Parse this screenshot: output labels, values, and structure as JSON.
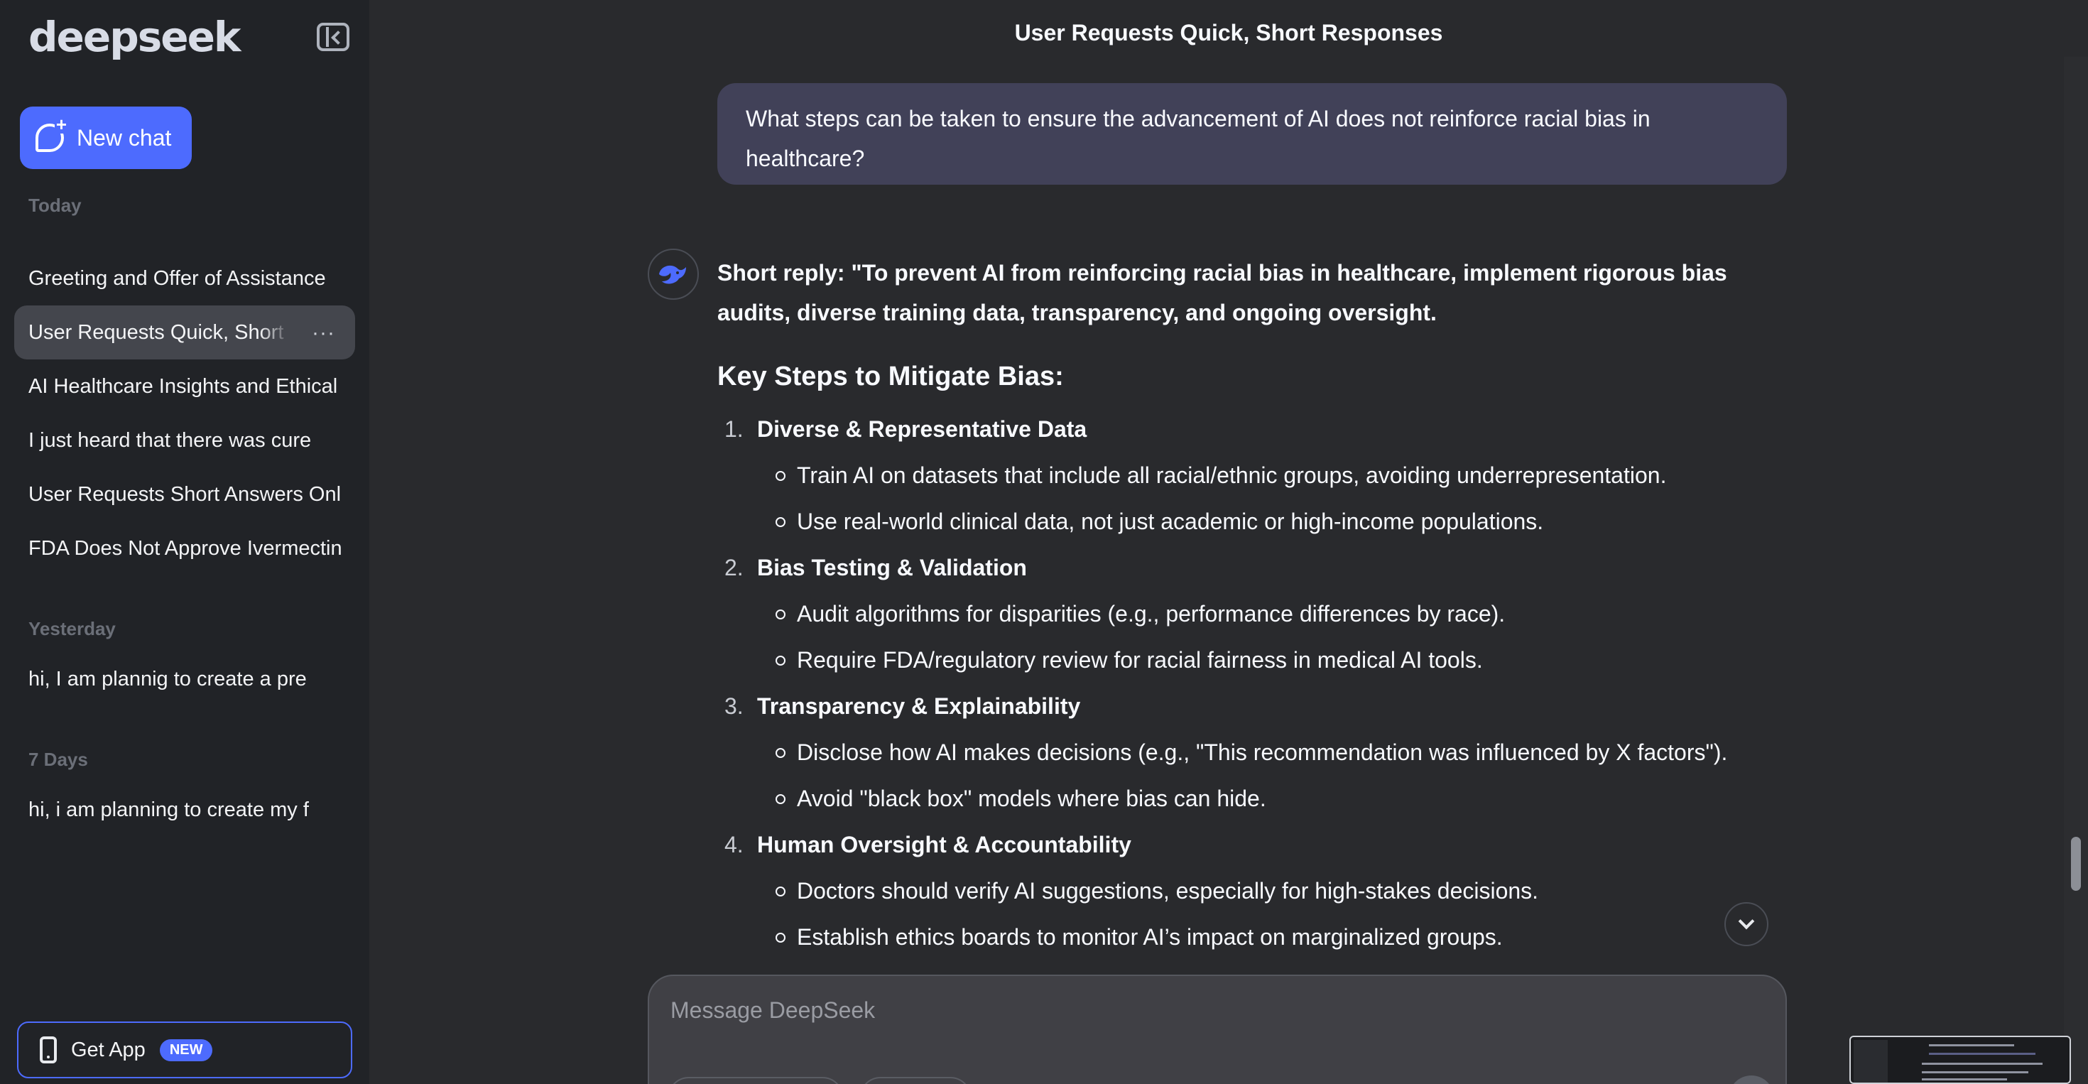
{
  "sidebar": {
    "logo": "deepseek",
    "new_chat": "New chat",
    "sections": [
      {
        "label": "Today",
        "items": [
          "Greeting and Offer of Assistance",
          "User Requests Quick, Short Responses",
          "AI Healthcare Insights and Ethical",
          "I just heard that there was cure",
          "User Requests Short Answers Only",
          "FDA Does Not Approve Ivermectin"
        ]
      },
      {
        "label": "Yesterday",
        "items": [
          "hi, I am plannig to create a pre"
        ]
      },
      {
        "label": "7 Days",
        "items": [
          "hi, i am planning to create my f"
        ]
      }
    ],
    "more_glyph": "···",
    "get_app": "Get App",
    "new_badge": "NEW"
  },
  "header": {
    "title": "User Requests Quick, Short Responses"
  },
  "conversation": {
    "user_message": "What steps can be taken to ensure the advancement of AI does not reinforce racial bias in healthcare?",
    "short_reply": "Short reply: \"To prevent AI from reinforcing racial bias in healthcare, implement rigorous bias audits, diverse training data, transparency, and ongoing oversight.",
    "heading": "Key Steps to Mitigate Bias:",
    "steps": [
      {
        "num": "1.",
        "title": "Diverse & Representative Data",
        "points": [
          "Train AI on datasets that include all racial/ethnic groups, avoiding underrepresentation.",
          "Use real-world clinical data, not just academic or high-income populations."
        ]
      },
      {
        "num": "2.",
        "title": "Bias Testing & Validation",
        "points": [
          "Audit algorithms for disparities (e.g., performance differences by race).",
          "Require FDA/regulatory review for racial fairness in medical AI tools."
        ]
      },
      {
        "num": "3.",
        "title": "Transparency & Explainability",
        "points": [
          "Disclose how AI makes decisions (e.g., \"This recommendation was influenced by X factors\").",
          "Avoid \"black box\" models where bias can hide."
        ]
      },
      {
        "num": "4.",
        "title": "Human Oversight & Accountability",
        "points": [
          "Doctors should verify AI suggestions, especially for high-stakes decisions.",
          "Establish ethics boards to monitor AI’s impact on marginalized groups."
        ]
      }
    ]
  },
  "composer": {
    "placeholder": "Message DeepSeek"
  },
  "colors": {
    "accent": "#4d6bfe",
    "sidebar_bg": "#212327",
    "main_bg": "#292a2d",
    "user_bubble": "#414158"
  }
}
